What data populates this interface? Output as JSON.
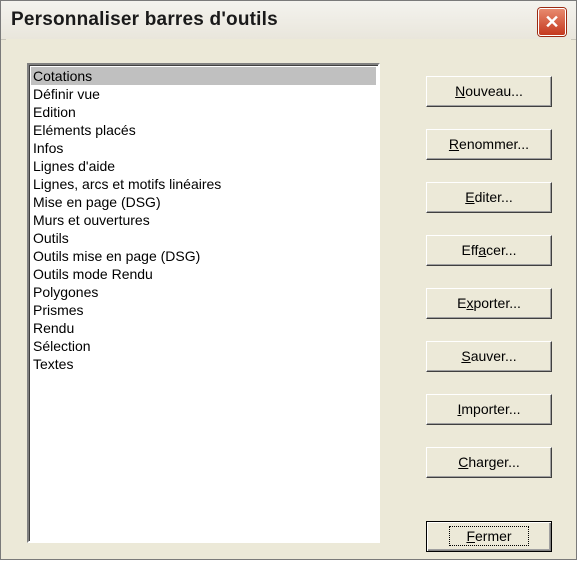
{
  "window": {
    "title": "Personnaliser barres d'outils",
    "close_glyph": "✕"
  },
  "list": {
    "items": [
      "Cotations",
      "Définir vue",
      "Edition",
      "Eléments placés",
      "Infos",
      "Lignes d'aide",
      "Lignes, arcs et motifs linéaires",
      "Mise en page (DSG)",
      "Murs et ouvertures",
      "Outils",
      "Outils mise en page (DSG)",
      "Outils mode Rendu",
      "Polygones",
      "Prismes",
      "Rendu",
      "Sélection",
      "Textes"
    ],
    "selected": "Cotations"
  },
  "buttons": {
    "nouveau": {
      "pre": "",
      "key": "N",
      "post": "ouveau..."
    },
    "renommer": {
      "pre": "",
      "key": "R",
      "post": "enommer..."
    },
    "editer": {
      "pre": "",
      "key": "E",
      "post": "diter..."
    },
    "effacer": {
      "pre": "Eff",
      "key": "a",
      "post": "cer..."
    },
    "exporter": {
      "pre": "E",
      "key": "x",
      "post": "porter..."
    },
    "sauver": {
      "pre": "",
      "key": "S",
      "post": "auver..."
    },
    "importer": {
      "pre": "",
      "key": "I",
      "post": "mporter..."
    },
    "charger": {
      "pre": "",
      "key": "C",
      "post": "harger..."
    },
    "fermer": {
      "pre": "",
      "key": "F",
      "post": "ermer"
    }
  }
}
